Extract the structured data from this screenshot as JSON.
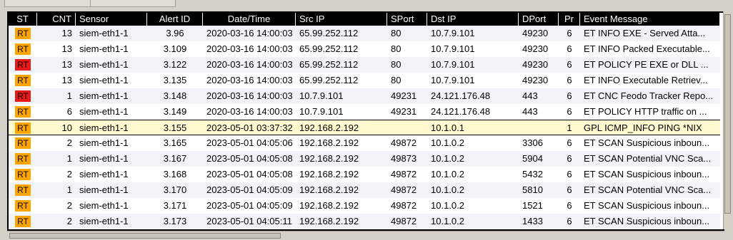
{
  "columns": [
    "ST",
    "CNT",
    "Sensor",
    "Alert ID",
    "Date/Time",
    "Src IP",
    "SPort",
    "Dst IP",
    "DPort",
    "Pr",
    "Event Message"
  ],
  "rows": [
    {
      "st": "RT",
      "st_color": "#ffa500",
      "cnt": "13",
      "sensor": "siem-eth1-1",
      "alert_id": "3.96",
      "datetime": "2020-03-16 14:00:03",
      "src_ip": "65.99.252.112",
      "sport": "80",
      "dst_ip": "10.7.9.101",
      "dport": "49230",
      "pr": "6",
      "msg": "ET INFO EXE - Served Atta..."
    },
    {
      "st": "RT",
      "st_color": "#ffa500",
      "cnt": "13",
      "sensor": "siem-eth1-1",
      "alert_id": "3.109",
      "datetime": "2020-03-16 14:00:03",
      "src_ip": "65.99.252.112",
      "sport": "80",
      "dst_ip": "10.7.9.101",
      "dport": "49230",
      "pr": "6",
      "msg": "ET INFO Packed Executable..."
    },
    {
      "st": "RT",
      "st_color": "#e8191b",
      "cnt": "13",
      "sensor": "siem-eth1-1",
      "alert_id": "3.122",
      "datetime": "2020-03-16 14:00:03",
      "src_ip": "65.99.252.112",
      "sport": "80",
      "dst_ip": "10.7.9.101",
      "dport": "49230",
      "pr": "6",
      "msg": "ET POLICY PE EXE or DLL ..."
    },
    {
      "st": "RT",
      "st_color": "#ffa500",
      "cnt": "13",
      "sensor": "siem-eth1-1",
      "alert_id": "3.135",
      "datetime": "2020-03-16 14:00:03",
      "src_ip": "65.99.252.112",
      "sport": "80",
      "dst_ip": "10.7.9.101",
      "dport": "49230",
      "pr": "6",
      "msg": "ET INFO Executable Retriev..."
    },
    {
      "st": "RT",
      "st_color": "#e8191b",
      "cnt": "1",
      "sensor": "siem-eth1-1",
      "alert_id": "3.148",
      "datetime": "2020-03-16 14:00:03",
      "src_ip": "10.7.9.101",
      "sport": "49231",
      "dst_ip": "24.121.176.48",
      "dport": "443",
      "pr": "6",
      "msg": "ET CNC Feodo Tracker Repo..."
    },
    {
      "st": "RT",
      "st_color": "#ffa500",
      "cnt": "6",
      "sensor": "siem-eth1-1",
      "alert_id": "3.149",
      "datetime": "2020-03-16 14:00:03",
      "src_ip": "10.7.9.101",
      "sport": "49231",
      "dst_ip": "24.121.176.48",
      "dport": "443",
      "pr": "6",
      "msg": "ET POLICY HTTP traffic on ..."
    },
    {
      "st": "RT",
      "st_color": "#ffa500",
      "cnt": "10",
      "sensor": "siem-eth1-1",
      "alert_id": "3.155",
      "datetime": "2023-05-01 03:37:32",
      "src_ip": "192.168.2.192",
      "sport": "",
      "dst_ip": "10.1.0.1",
      "dport": "",
      "pr": "1",
      "msg": "GPL ICMP_INFO PING *NIX"
    },
    {
      "st": "RT",
      "st_color": "#ffa500",
      "cnt": "2",
      "sensor": "siem-eth1-1",
      "alert_id": "3.165",
      "datetime": "2023-05-01 04:05:06",
      "src_ip": "192.168.2.192",
      "sport": "49872",
      "dst_ip": "10.1.0.2",
      "dport": "3306",
      "pr": "6",
      "msg": "ET SCAN Suspicious inboun..."
    },
    {
      "st": "RT",
      "st_color": "#ffa500",
      "cnt": "1",
      "sensor": "siem-eth1-1",
      "alert_id": "3.167",
      "datetime": "2023-05-01 04:05:08",
      "src_ip": "192.168.2.192",
      "sport": "49873",
      "dst_ip": "10.1.0.2",
      "dport": "5904",
      "pr": "6",
      "msg": "ET SCAN Potential VNC Sca..."
    },
    {
      "st": "RT",
      "st_color": "#ffa500",
      "cnt": "2",
      "sensor": "siem-eth1-1",
      "alert_id": "3.168",
      "datetime": "2023-05-01 04:05:08",
      "src_ip": "192.168.2.192",
      "sport": "49872",
      "dst_ip": "10.1.0.2",
      "dport": "5432",
      "pr": "6",
      "msg": "ET SCAN Suspicious inboun..."
    },
    {
      "st": "RT",
      "st_color": "#ffa500",
      "cnt": "1",
      "sensor": "siem-eth1-1",
      "alert_id": "3.170",
      "datetime": "2023-05-01 04:05:09",
      "src_ip": "192.168.2.192",
      "sport": "49872",
      "dst_ip": "10.1.0.2",
      "dport": "5810",
      "pr": "6",
      "msg": "ET SCAN Potential VNC Sca..."
    },
    {
      "st": "RT",
      "st_color": "#ffa500",
      "cnt": "2",
      "sensor": "siem-eth1-1",
      "alert_id": "3.171",
      "datetime": "2023-05-01 04:05:09",
      "src_ip": "192.168.2.192",
      "sport": "49872",
      "dst_ip": "10.1.0.2",
      "dport": "1521",
      "pr": "6",
      "msg": "ET SCAN Suspicious inboun..."
    },
    {
      "st": "RT",
      "st_color": "#ffa500",
      "cnt": "2",
      "sensor": "siem-eth1-1",
      "alert_id": "3.173",
      "datetime": "2023-05-01 04:05:11",
      "src_ip": "192.168.2.192",
      "sport": "49872",
      "dst_ip": "10.1.0.2",
      "dport": "1433",
      "pr": "6",
      "msg": "ET SCAN Suspicious inboun..."
    }
  ],
  "selected_row": 6,
  "colors": {
    "header_bg": "#000000",
    "row_alt": "#f2f3f7",
    "selected": "#fffad0",
    "rt_orange": "#ffa500",
    "rt_red": "#e8191b"
  }
}
